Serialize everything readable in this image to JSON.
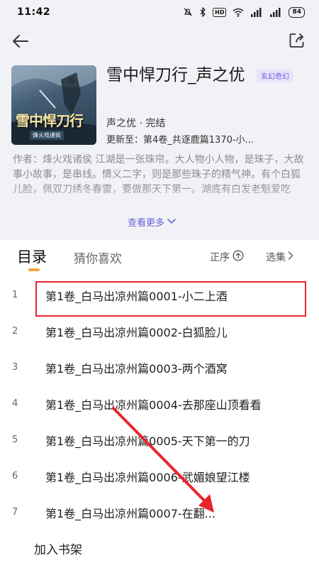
{
  "status_bar": {
    "time": "11:42",
    "icons": [
      "mute-icon",
      "bluetooth-icon",
      "hd-icon",
      "wifi-icon",
      "signal-icon",
      "signal-icon"
    ],
    "hd_label": "HD",
    "battery": "84"
  },
  "book": {
    "title": "雪中悍刀行_声之优",
    "genre": "玄幻奇幻",
    "author_status": "声之优 · 完结",
    "update": "更新至：第4卷_共逐鹿篇1370-小...",
    "cover_title": "雪中悍刀行",
    "cover_subtitle": "烽火戏诸侯",
    "description": "作者：烽火戏诸侯 江湖是一张珠帘。大人物小人物，是珠子，大故事小故事，是串线。情义二字，则是那些珠子的精气神。有个白狐儿脸，佩双刀绣冬春雷，要做那天下第一。湖底有白发老魁爱吃",
    "more": "查看更多"
  },
  "tabs": {
    "toc": "目录",
    "recommend": "猜你喜欢",
    "sort": "正序",
    "select": "选集"
  },
  "chapters": [
    {
      "num": "1",
      "title": "第1卷_白马出凉州篇0001-小二上酒"
    },
    {
      "num": "2",
      "title": "第1卷_白马出凉州篇0002-白狐脸儿"
    },
    {
      "num": "3",
      "title": "第1卷_白马出凉州篇0003-两个酒窝"
    },
    {
      "num": "4",
      "title": "第1卷_白马出凉州篇0004-去那座山顶看看"
    },
    {
      "num": "5",
      "title": "第1卷_白马出凉州篇0005-天下第一的刀"
    },
    {
      "num": "6",
      "title": "第1卷_白马出凉州篇0006-武媚娘望江楼"
    },
    {
      "num": "7",
      "title": "第1卷_白马出凉州篇0007-在翻..."
    }
  ],
  "bottom": {
    "add_shelf": "加入书架"
  },
  "colors": {
    "accent": "#6b5fd8",
    "tab_indicator": "#f3a43c",
    "highlight": "#e8262a"
  }
}
